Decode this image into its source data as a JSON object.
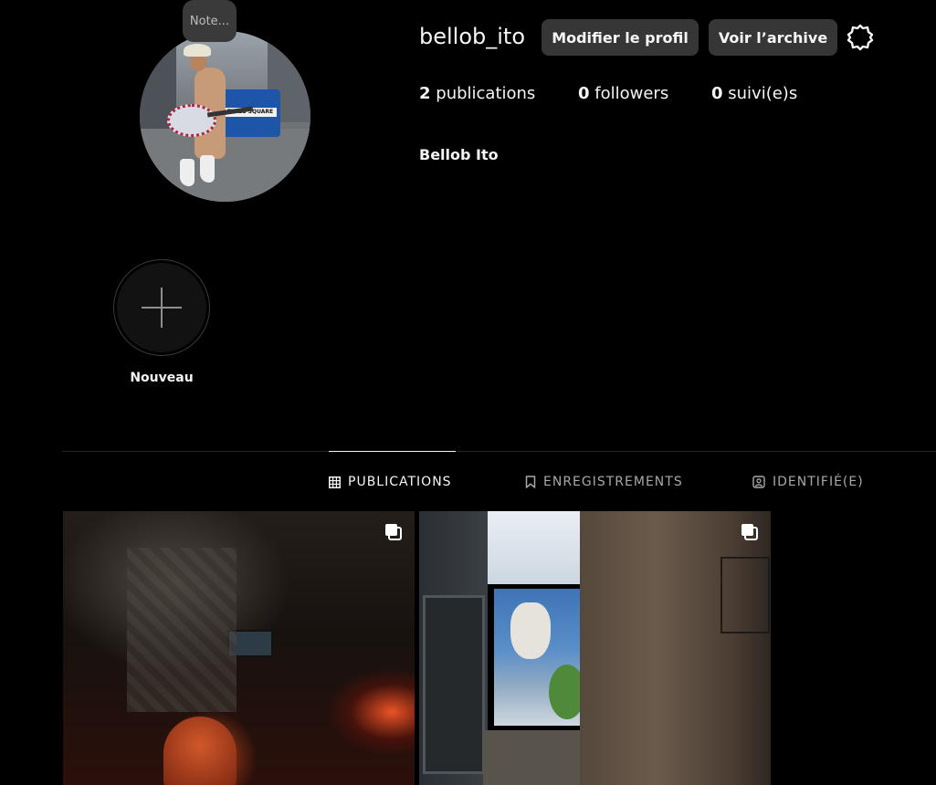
{
  "profile": {
    "username": "bellob_ito",
    "full_name": "Bellob Ito",
    "note_label": "Note...",
    "avatar_sign": "TIMES SQUARE",
    "edit_button": "Modifier le profil",
    "archive_button": "Voir l’archive",
    "settings_icon": "gear-icon"
  },
  "stats": {
    "posts_count": "2",
    "posts_label": "publications",
    "followers_count": "0",
    "followers_label": "followers",
    "following_count": "0",
    "following_label": "suivi(e)s"
  },
  "highlights": {
    "new_label": "Nouveau",
    "new_icon": "plus-icon"
  },
  "tabs": [
    {
      "label": "PUBLICATIONS",
      "icon": "grid-icon",
      "active": true
    },
    {
      "label": "ENREGISTREMENTS",
      "icon": "bookmark-icon",
      "active": false
    },
    {
      "label": "IDENTIFIÉ(E)",
      "icon": "tagged-icon",
      "active": false
    }
  ],
  "posts": [
    {
      "icon": "carousel-icon"
    },
    {
      "icon": "carousel-icon"
    }
  ],
  "colors": {
    "background": "#000000",
    "button_bg": "#363636",
    "text": "#f5f5f5",
    "muted_text": "#a8a8a8",
    "divider": "#262626"
  }
}
